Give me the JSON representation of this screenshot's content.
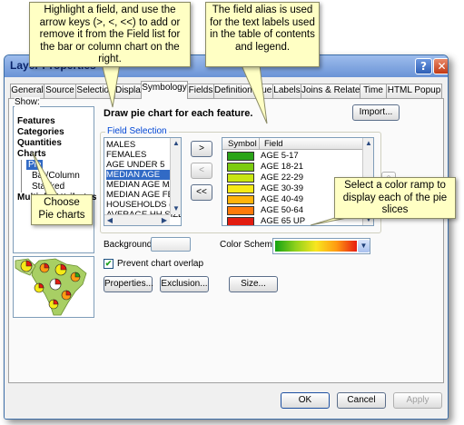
{
  "window": {
    "title": "Layer Properties"
  },
  "tabs": [
    "General",
    "Source",
    "Selection",
    "Display",
    "Symbology",
    "Fields",
    "Definition Query",
    "Labels",
    "Joins & Relates",
    "Time",
    "HTML Popup"
  ],
  "show": {
    "label": "Show:",
    "items": [
      "Features",
      "Categories",
      "Quantities",
      "Charts",
      "Pie",
      "Bar/Column",
      "Stacked",
      "Multiple Attributes"
    ]
  },
  "main": {
    "draw_title": "Draw pie chart for each feature.",
    "import_label": "Import...",
    "field_selection_label": "Field Selection",
    "field_list": [
      "MALES",
      "FEMALES",
      "AGE UNDER 5",
      "MEDIAN AGE",
      "MEDIAN AGE MALE",
      "MEDIAN AGE FEM",
      "HOUSEHOLDS (HH",
      "AVERAGE HH SIZE"
    ],
    "selected_field": "MEDIAN AGE",
    "move_buttons": [
      ">",
      "<",
      "<<"
    ],
    "symbol_header": "Symbol",
    "field_header": "Field",
    "symbol_rows": [
      {
        "label": "AGE 5-17",
        "color": "#2aa418"
      },
      {
        "label": "AGE 18-21",
        "color": "#7ccc10"
      },
      {
        "label": "AGE 22-29",
        "color": "#c8e612"
      },
      {
        "label": "AGE 30-39",
        "color": "#f6ea16"
      },
      {
        "label": "AGE 40-49",
        "color": "#ffb30a"
      },
      {
        "label": "AGE 50-64",
        "color": "#ff7a0a"
      },
      {
        "label": "AGE 65 UP",
        "color": "#e21c10"
      }
    ],
    "background_label": "Background:",
    "color_scheme_label": "Color Scheme:",
    "prevent_overlap_label": "Prevent chart overlap",
    "prevent_overlap_checked": "✔",
    "properties_label": "Properties...",
    "exclusion_label": "Exclusion...",
    "size_label": "Size..."
  },
  "footer": {
    "ok": "OK",
    "cancel": "Cancel",
    "apply": "Apply"
  },
  "callouts": {
    "highlight": "Highlight a field, and use the arrow keys (>, <, <<) to add or remove it from the Field list for the bar or column chart on the right.",
    "alias": "The field alias is used for the text labels used in the table of contents and legend.",
    "ramp": "Select a color ramp to display each of the pie slices",
    "pie": "Choose Pie charts"
  }
}
